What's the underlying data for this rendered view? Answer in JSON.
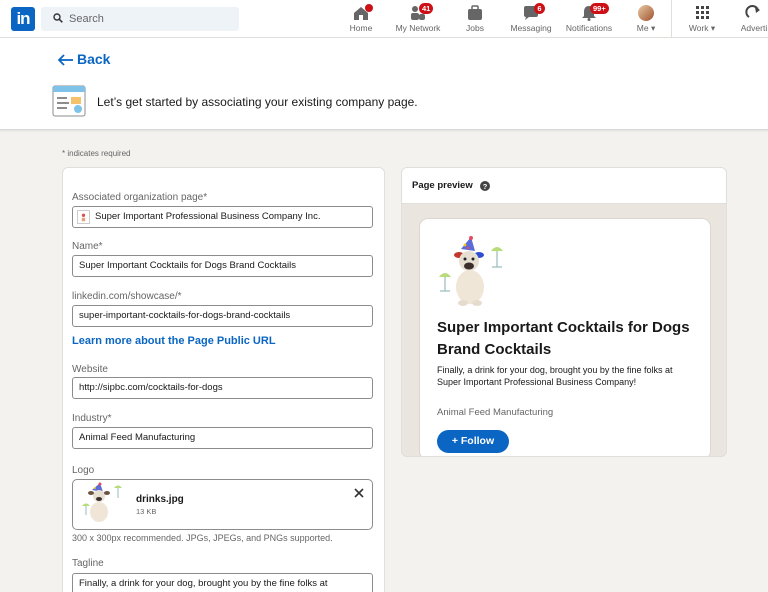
{
  "nav": {
    "search_placeholder": "Search",
    "items": [
      {
        "label": "Home",
        "icon": "home-icon",
        "badge": ""
      },
      {
        "label": "My Network",
        "icon": "network-icon",
        "badge": "41"
      },
      {
        "label": "Jobs",
        "icon": "jobs-icon",
        "badge": ""
      },
      {
        "label": "Messaging",
        "icon": "messaging-icon",
        "badge": "6"
      },
      {
        "label": "Notifications",
        "icon": "bell-icon",
        "badge": "99+"
      },
      {
        "label": "Me ▾",
        "icon": "avatar"
      },
      {
        "label": "Work ▾",
        "icon": "grid-icon"
      },
      {
        "label": "Adverti",
        "icon": "advertise-icon"
      }
    ]
  },
  "header": {
    "back_label": "Back",
    "intro": "Let’s get started by associating your existing company page."
  },
  "form": {
    "required_note": "* indicates required",
    "org_label": "Associated organization page*",
    "org_value": "Super Important Professional Business Company Inc.",
    "name_label": "Name*",
    "name_value": "Super Important Cocktails for Dogs Brand Cocktails",
    "url_label": "linkedin.com/showcase/*",
    "url_value": "super-important-cocktails-for-dogs-brand-cocktails",
    "learn_link": "Learn more about the Page Public URL",
    "website_label": "Website",
    "website_value": "http://sipbc.com/cocktails-for-dogs",
    "industry_label": "Industry*",
    "industry_value": "Animal Feed Manufacturing",
    "logo_label": "Logo",
    "logo_file": "drinks.jpg",
    "logo_size": "13 KB",
    "logo_hint": "300 x 300px recommended. JPGs, JPEGs, and PNGs supported.",
    "tagline_label": "Tagline",
    "tagline_value": "Finally, a drink for your dog, brought you by the fine folks at"
  },
  "preview": {
    "title": "Page preview",
    "name": "Super Important Cocktails for Dogs Brand Cocktails",
    "tagline": "Finally, a drink for your dog, brought you by the fine folks at Super Important Professional Business Company!",
    "industry": "Animal Feed Manufacturing",
    "follow_label": "+ Follow"
  },
  "colors": {
    "brand": "#0a66c2",
    "badge": "#cc1016",
    "background": "#f3f2ef"
  }
}
